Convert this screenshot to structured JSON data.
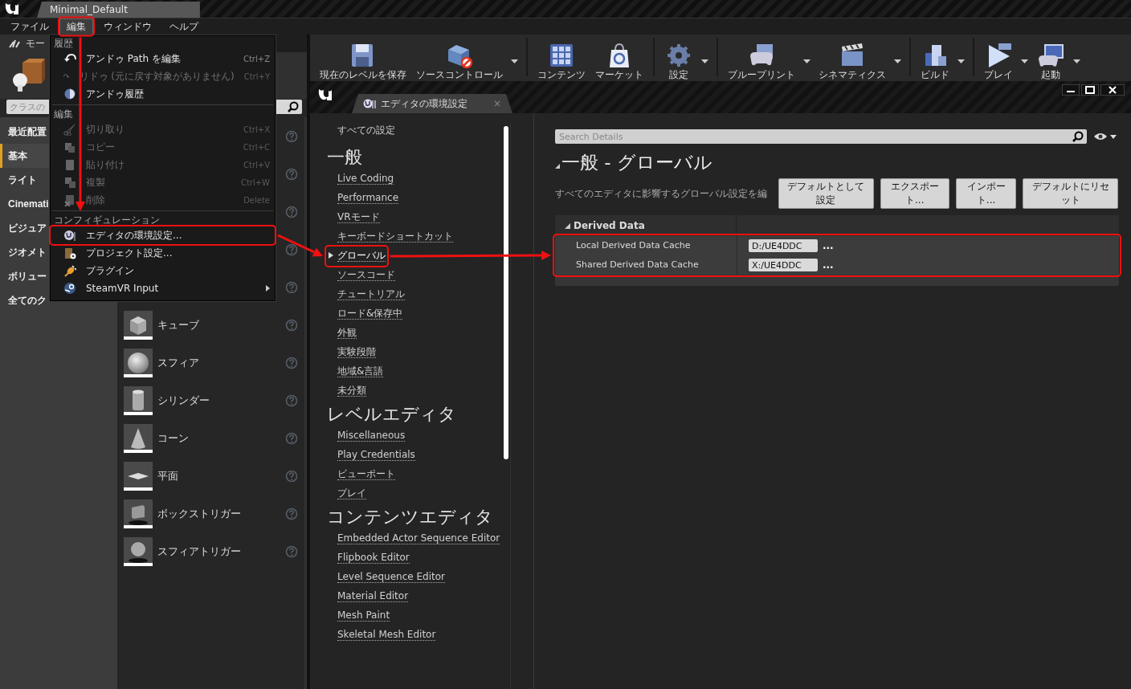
{
  "title_tab": "Minimal_Default",
  "menu_bar": [
    {
      "label": "ファイル",
      "selected": false
    },
    {
      "label": "編集",
      "selected": true
    },
    {
      "label": "ウィンドウ",
      "selected": false
    },
    {
      "label": "ヘルプ",
      "selected": false
    }
  ],
  "modes_panel": {
    "tab": "モー",
    "search": {
      "placeholder": "クラスの"
    },
    "categories": [
      {
        "label": "最近配置",
        "selected": false
      },
      {
        "label": "基本",
        "selected": true
      },
      {
        "label": "ライト",
        "selected": false
      },
      {
        "label": "Cinemati",
        "selected": false
      },
      {
        "label": "ビジュア",
        "selected": false
      },
      {
        "label": "ジオメト",
        "selected": false
      },
      {
        "label": "ボリュー",
        "selected": false
      },
      {
        "label": "全てのク",
        "selected": false
      }
    ],
    "items": [
      {
        "help_icon": true
      },
      {
        "help_icon": true
      },
      {
        "help_icon": true
      },
      {
        "help_icon": true
      },
      {
        "help_icon": true
      },
      {
        "label": "キューブ",
        "help_icon": true
      },
      {
        "label": "スフィア",
        "help_icon": true
      },
      {
        "label": "シリンダー",
        "help_icon": true
      },
      {
        "label": "コーン",
        "help_icon": true
      },
      {
        "label": "平面",
        "help_icon": true
      },
      {
        "label": "ボックストリガー",
        "help_icon": true
      },
      {
        "label": "スフィアトリガー",
        "help_icon": true
      }
    ]
  },
  "edit_menu": {
    "sections": [
      {
        "header": "履歴",
        "items": [
          {
            "label": "アンドゥ Path を編集",
            "shortcut": "Ctrl+Z",
            "disabled": false
          },
          {
            "label": "リドゥ (元に戻す対象がありません)",
            "shortcut": "Ctrl+Y",
            "disabled": true
          },
          {
            "label": "アンドゥ履歴",
            "disabled": false
          }
        ]
      },
      {
        "header": "編集",
        "items": [
          {
            "label": "切り取り",
            "shortcut": "Ctrl+X",
            "disabled": true
          },
          {
            "label": "コピー",
            "shortcut": "Ctrl+C",
            "disabled": true
          },
          {
            "label": "貼り付け",
            "shortcut": "Ctrl+V",
            "disabled": true
          },
          {
            "label": "複製",
            "shortcut": "Ctrl+W",
            "disabled": true
          },
          {
            "label": "削除",
            "shortcut": "Delete",
            "disabled": true
          }
        ]
      },
      {
        "header": "コンフィギュレーション",
        "items": [
          {
            "label": "エディタの環境設定...",
            "disabled": false
          },
          {
            "label": "プロジェクト設定...",
            "disabled": false
          },
          {
            "label": "プラグイン",
            "disabled": false
          },
          {
            "label": "SteamVR Input",
            "disabled": false,
            "submenu": true
          }
        ]
      }
    ]
  },
  "toolbar": [
    {
      "label": "現在のレベルを保存",
      "dropdown": false,
      "separator_before": false
    },
    {
      "label": "ソースコントロール",
      "dropdown": true,
      "separator_before": false
    },
    {
      "label": "コンテンツ",
      "dropdown": false,
      "separator_before": true
    },
    {
      "label": "マーケット",
      "dropdown": false,
      "separator_before": false
    },
    {
      "label": "設定",
      "dropdown": true,
      "separator_before": true
    },
    {
      "label": "ブループリント",
      "dropdown": true,
      "separator_before": true
    },
    {
      "label": "シネマティクス",
      "dropdown": true,
      "separator_before": false
    },
    {
      "label": "ビルド",
      "dropdown": true,
      "separator_before": true
    },
    {
      "label": "プレイ",
      "dropdown": true,
      "separator_before": true
    },
    {
      "label": "起動",
      "dropdown": true,
      "separator_before": false
    }
  ],
  "settings_window": {
    "tab": "エディタの環境設定",
    "tab_close": "×",
    "nav": {
      "all_settings": "すべての設定",
      "sections": [
        {
          "title": "一般",
          "links": [
            {
              "label": "Live Coding",
              "selected": false
            },
            {
              "label": "Performance",
              "selected": false
            },
            {
              "label": "VRモード",
              "selected": false
            },
            {
              "label": "キーボードショートカット",
              "selected": false
            },
            {
              "label": "グローバル",
              "selected": true
            },
            {
              "label": "ソースコード",
              "selected": false
            },
            {
              "label": "チュートリアル",
              "selected": false
            },
            {
              "label": "ロード&保存中",
              "selected": false
            },
            {
              "label": "外観",
              "selected": false
            },
            {
              "label": "実験段階",
              "selected": false
            },
            {
              "label": "地域&言語",
              "selected": false
            },
            {
              "label": "未分類",
              "selected": false
            }
          ]
        },
        {
          "title": "レベルエディタ",
          "links": [
            {
              "label": "Miscellaneous",
              "selected": false
            },
            {
              "label": "Play Credentials",
              "selected": false
            },
            {
              "label": "ビューポート",
              "selected": false
            },
            {
              "label": "プレイ",
              "selected": false
            }
          ]
        },
        {
          "title": "コンテンツエディタ",
          "links": [
            {
              "label": "Embedded Actor Sequence Editor",
              "selected": false
            },
            {
              "label": "Flipbook Editor",
              "selected": false
            },
            {
              "label": "Level Sequence Editor",
              "selected": false
            },
            {
              "label": "Material Editor",
              "selected": false
            },
            {
              "label": "Mesh Paint",
              "selected": false
            },
            {
              "label": "Skeletal Mesh Editor",
              "selected": false
            }
          ]
        }
      ]
    },
    "search": {
      "placeholder": "Search Details"
    },
    "heading": "一般 - グローバル",
    "description": "すべてのエディタに影響するグローバル設定を編",
    "buttons": [
      "デフォルトとして設定",
      "エクスポート...",
      "インポート...",
      "デフォルトにリセット"
    ],
    "category": {
      "title": "Derived Data",
      "expanded": true,
      "rows": [
        {
          "label": "Local Derived Data Cache",
          "value": "D:/UE4DDC",
          "browse": "..."
        },
        {
          "label": "Shared Derived Data Cache",
          "value": "X:/UE4DDC",
          "browse": "..."
        }
      ]
    }
  }
}
